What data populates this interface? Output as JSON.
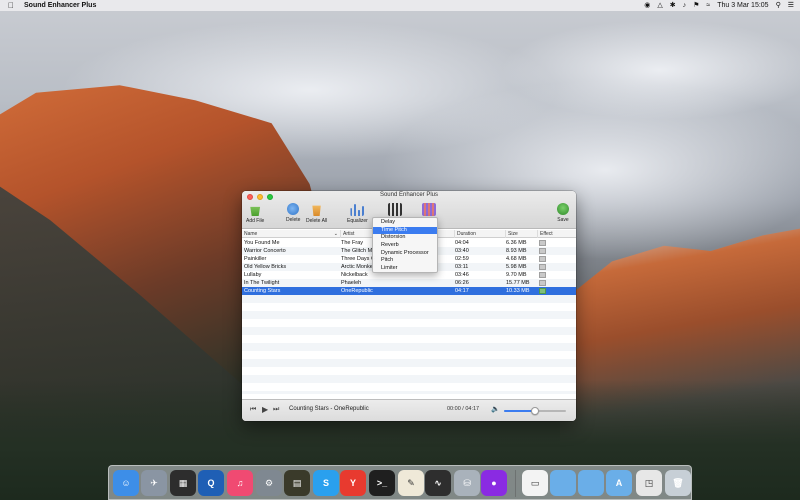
{
  "menubar": {
    "app_name": "Sound Enhancer Plus",
    "datetime": "Thu 3 Mar  15:05"
  },
  "window": {
    "title": "Sound Enhancer Plus",
    "toolbar": {
      "add_file": "Add File",
      "delete": "Delete",
      "delete_all": "Delete All",
      "equalizer": "Equalizer",
      "save": "Save"
    },
    "columns": {
      "name": "Name",
      "artist": "Artist",
      "duration": "Duration",
      "size": "Size",
      "effect": "Effect"
    },
    "rows": [
      {
        "name": "You Found Me",
        "artist": "The Fray",
        "duration": "04:04",
        "size": "6.36 MB"
      },
      {
        "name": "Warrior Concerto",
        "artist": "The Glitch M",
        "duration": "03:40",
        "size": "8.93 MB"
      },
      {
        "name": "Painkiller",
        "artist": "Three Days G",
        "duration": "02:59",
        "size": "4.68 MB"
      },
      {
        "name": "Old Yellow Bricks",
        "artist": "Arctic Monke",
        "duration": "03:11",
        "size": "5.98 MB"
      },
      {
        "name": "Lullaby",
        "artist": "Nickelback",
        "duration": "03:46",
        "size": "9.70 MB"
      },
      {
        "name": "In The Twilight",
        "artist": "Phaeleh",
        "duration": "06:26",
        "size": "15.77 MB"
      },
      {
        "name": "Counting Stars",
        "artist": "OneRepublic",
        "duration": "04:17",
        "size": "10.33 MB",
        "selected": true
      }
    ],
    "effect_menu": [
      "Delay",
      "Time Pitch",
      "Distorsion",
      "Reverb",
      "Dynamic Processor",
      "Pitch",
      "Limiter"
    ],
    "effect_menu_highlighted": "Time Pitch",
    "player": {
      "now_playing": "Counting Stars - OneRepublic",
      "time": "00:00 / 04:17",
      "volume": 0.5
    }
  },
  "dock": {
    "icons": [
      "finder-icon",
      "launchpad-icon",
      "dashboard-icon",
      "quicktime-icon",
      "itunes-icon",
      "system-preferences-icon",
      "console-icon",
      "skype-icon",
      "yandex-icon",
      "terminal-icon",
      "textedit-icon",
      "activity-monitor-icon",
      "disk-utility-icon",
      "app-icon",
      "document-icon",
      "folder-icon",
      "folder-icon",
      "applications-folder-icon",
      "preview-icon",
      "trash-icon"
    ]
  }
}
